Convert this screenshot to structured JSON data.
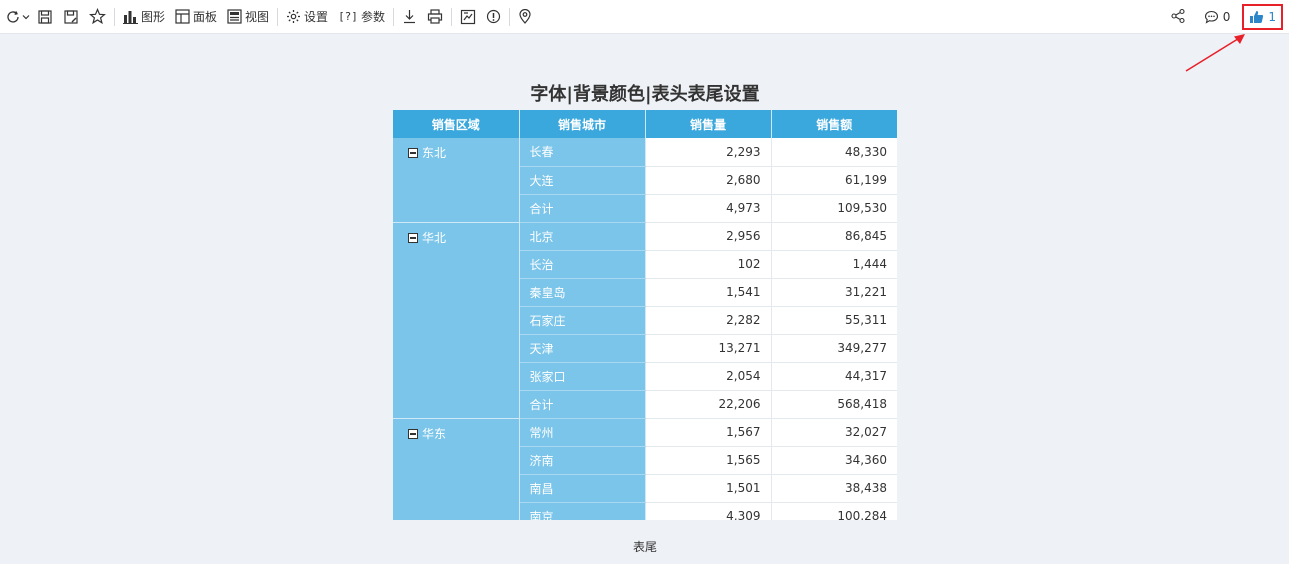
{
  "toolbar": {
    "chart_label": "图形",
    "panel_label": "面板",
    "view_label": "视图",
    "settings_label": "设置",
    "param_prefix": "[?]",
    "param_label": "参数",
    "comment_count": "0",
    "like_count": "1"
  },
  "report": {
    "title": "字体|背景颜色|表头表尾设置",
    "footer": "表尾",
    "columns": [
      "销售区域",
      "销售城市",
      "销售量",
      "销售额"
    ],
    "groups": [
      {
        "region": "东北",
        "rows": [
          {
            "city": "长春",
            "qty": "2,293",
            "amount": "48,330"
          },
          {
            "city": "大连",
            "qty": "2,680",
            "amount": "61,199"
          },
          {
            "city": "合计",
            "qty": "4,973",
            "amount": "109,530"
          }
        ]
      },
      {
        "region": "华北",
        "rows": [
          {
            "city": "北京",
            "qty": "2,956",
            "amount": "86,845"
          },
          {
            "city": "长治",
            "qty": "102",
            "amount": "1,444"
          },
          {
            "city": "秦皇岛",
            "qty": "1,541",
            "amount": "31,221"
          },
          {
            "city": "石家庄",
            "qty": "2,282",
            "amount": "55,311"
          },
          {
            "city": "天津",
            "qty": "13,271",
            "amount": "349,277"
          },
          {
            "city": "张家口",
            "qty": "2,054",
            "amount": "44,317"
          },
          {
            "city": "合计",
            "qty": "22,206",
            "amount": "568,418"
          }
        ]
      },
      {
        "region": "华东",
        "rows": [
          {
            "city": "常州",
            "qty": "1,567",
            "amount": "32,027"
          },
          {
            "city": "济南",
            "qty": "1,565",
            "amount": "34,360"
          },
          {
            "city": "南昌",
            "qty": "1,501",
            "amount": "38,438"
          },
          {
            "city": "南京",
            "qty": "4,309",
            "amount": "100,284"
          }
        ]
      }
    ]
  },
  "colors": {
    "header_bg": "#3ba8dd",
    "dimension_bg": "#7cc5ea",
    "highlight_border": "#e8202a",
    "like_color": "#2d86c9"
  }
}
